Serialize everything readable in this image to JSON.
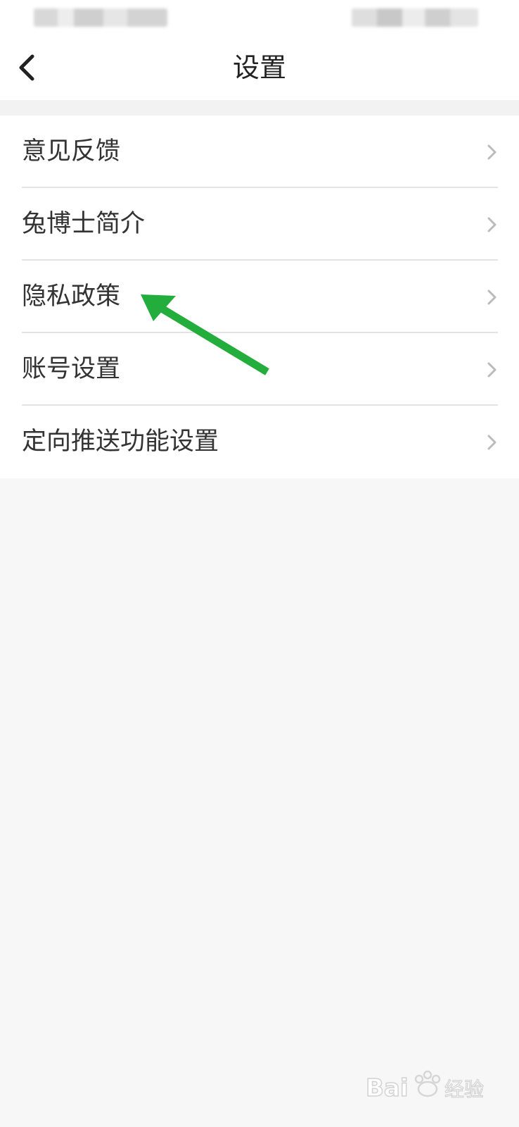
{
  "header": {
    "title": "设置"
  },
  "settings": {
    "items": [
      {
        "label": "意见反馈"
      },
      {
        "label": "兔博士简介"
      },
      {
        "label": "隐私政策"
      },
      {
        "label": "账号设置"
      },
      {
        "label": "定向推送功能设置"
      }
    ]
  },
  "icons": {
    "back": "chevron-left-icon",
    "item_chevron": "chevron-right-icon",
    "annotation": "green-arrow-icon"
  },
  "colors": {
    "annotation_arrow": "#22ad3c",
    "chevron": "#bbbbbb",
    "divider": "#e3e3e3",
    "page_background": "#f7f7f7"
  }
}
